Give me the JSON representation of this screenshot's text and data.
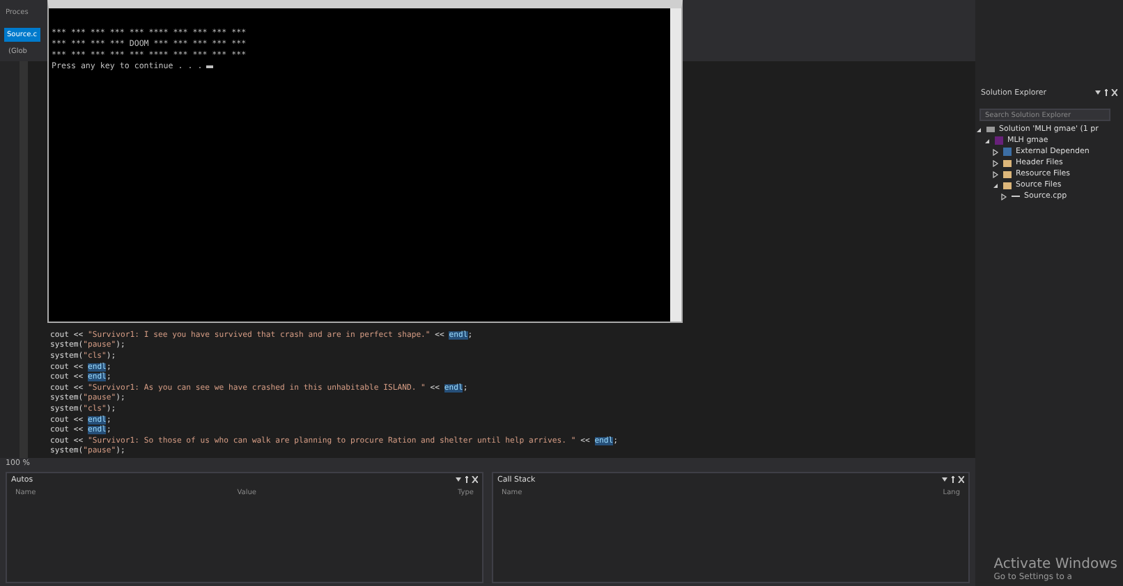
{
  "top_bar": {
    "label": "Proces"
  },
  "editor_tab": {
    "label": "Source.c",
    "selected": true
  },
  "scope_dropdown": {
    "value": "(Glob"
  },
  "console": {
    "lines": [
      "*** *** *** *** *** **** *** *** *** ***",
      "*** *** *** *** DOOM *** *** *** *** ***",
      "*** *** *** *** *** **** *** *** *** ***",
      "Press any key to continue . . ."
    ]
  },
  "code_lines": [
    {
      "parts": [
        {
          "kind": "plain",
          "text": "cout << "
        },
        {
          "kind": "string",
          "text": "\"Survivor1: I see you have survived that crash and are in perfect shape.\""
        },
        {
          "kind": "plain",
          "text": " << "
        },
        {
          "kind": "highlight",
          "text": "endl"
        },
        {
          "kind": "plain",
          "text": ";"
        }
      ]
    },
    {
      "parts": [
        {
          "kind": "plain",
          "text": "system("
        },
        {
          "kind": "string",
          "text": "\"pause\""
        },
        {
          "kind": "plain",
          "text": ");"
        }
      ]
    },
    {
      "parts": [
        {
          "kind": "plain",
          "text": "system("
        },
        {
          "kind": "string",
          "text": "\"cls\""
        },
        {
          "kind": "plain",
          "text": ");"
        }
      ]
    },
    {
      "parts": [
        {
          "kind": "plain",
          "text": "cout << "
        },
        {
          "kind": "highlight",
          "text": "endl"
        },
        {
          "kind": "plain",
          "text": ";"
        }
      ]
    },
    {
      "parts": [
        {
          "kind": "plain",
          "text": "cout << "
        },
        {
          "kind": "highlight",
          "text": "endl"
        },
        {
          "kind": "plain",
          "text": ";"
        }
      ]
    },
    {
      "parts": [
        {
          "kind": "plain",
          "text": "cout << "
        },
        {
          "kind": "string",
          "text": "\"Survivor1: As you can see we have crashed in this unhabitable ISLAND. \""
        },
        {
          "kind": "plain",
          "text": " << "
        },
        {
          "kind": "highlight",
          "text": "endl"
        },
        {
          "kind": "plain",
          "text": ";"
        }
      ]
    },
    {
      "parts": [
        {
          "kind": "plain",
          "text": "system("
        },
        {
          "kind": "string",
          "text": "\"pause\""
        },
        {
          "kind": "plain",
          "text": ");"
        }
      ]
    },
    {
      "parts": [
        {
          "kind": "plain",
          "text": "system("
        },
        {
          "kind": "string",
          "text": "\"cls\""
        },
        {
          "kind": "plain",
          "text": ");"
        }
      ]
    },
    {
      "parts": [
        {
          "kind": "plain",
          "text": "cout << "
        },
        {
          "kind": "highlight",
          "text": "endl"
        },
        {
          "kind": "plain",
          "text": ";"
        }
      ]
    },
    {
      "parts": [
        {
          "kind": "plain",
          "text": "cout << "
        },
        {
          "kind": "highlight",
          "text": "endl"
        },
        {
          "kind": "plain",
          "text": ";"
        }
      ]
    },
    {
      "parts": [
        {
          "kind": "plain",
          "text": "cout << "
        },
        {
          "kind": "string",
          "text": "\"Survivor1: So those of us who can walk are planning to procure Ration and shelter until help arrives. \""
        },
        {
          "kind": "plain",
          "text": " << "
        },
        {
          "kind": "highlight",
          "text": "endl"
        },
        {
          "kind": "plain",
          "text": ";"
        }
      ]
    },
    {
      "parts": [
        {
          "kind": "plain",
          "text": "system("
        },
        {
          "kind": "string",
          "text": "\"pause\""
        },
        {
          "kind": "plain",
          "text": ");"
        }
      ]
    }
  ],
  "zoom": "100 %",
  "panels": [
    {
      "title": "Autos",
      "columns": [
        "Name",
        "Value",
        "Type"
      ]
    },
    {
      "title": "Call Stack",
      "columns": [
        "Name",
        "Lang"
      ]
    }
  ],
  "solution_explorer": {
    "title": "Solution Explorer",
    "search": {
      "placeholder": "Search Solution Explorer"
    },
    "tree": [
      {
        "label": "Solution 'MLH gmae' (1 pr",
        "kind": "solution",
        "expanded": true,
        "children": [
          {
            "label": "MLH gmae",
            "kind": "project",
            "expanded": true,
            "children": [
              {
                "label": "External Dependen",
                "kind": "deps",
                "expanded": false
              },
              {
                "label": "Header Files",
                "kind": "folder",
                "expanded": false
              },
              {
                "label": "Resource Files",
                "kind": "folder",
                "expanded": false
              },
              {
                "label": "Source Files",
                "kind": "folder",
                "expanded": true,
                "children": [
                  {
                    "label": "Source.cpp",
                    "kind": "file",
                    "expanded": false
                  }
                ]
              }
            ]
          }
        ]
      }
    ]
  },
  "activation_notice": {
    "title": "Activate Windows",
    "subtitle": "Go to Settings to a"
  }
}
